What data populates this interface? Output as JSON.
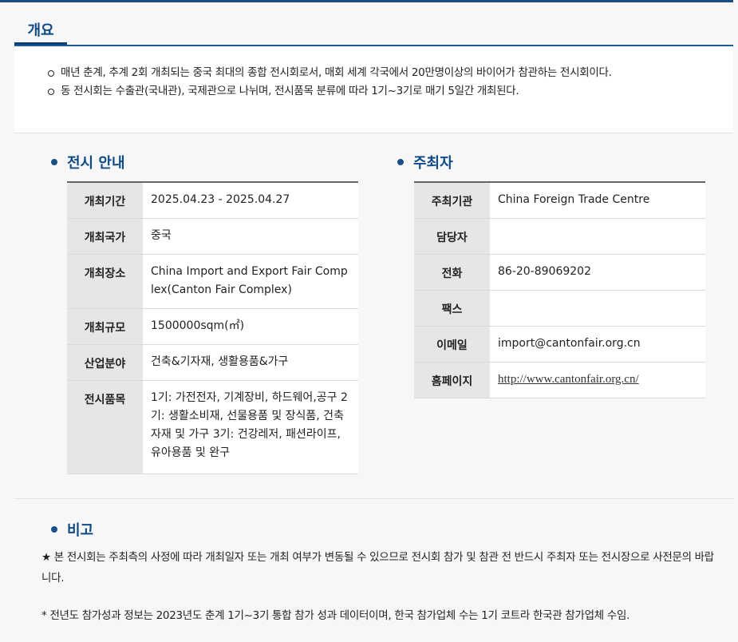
{
  "tab": {
    "label": "개요"
  },
  "overview": {
    "items": [
      "매년 춘계, 추계 2회 개최되는 중국 최대의 종합 전시회로서, 매회 세계 각국에서 20만명이상의 바이어가 참관하는 전시회이다.",
      "동 전시회는 수출관(국내관), 국제관으로 나뉘며, 전시품목 분류에 따라 1기~3기로 매기 5일간 개최된다."
    ]
  },
  "exhibition": {
    "title": "전시 안내",
    "rows": [
      {
        "label": "개최기간",
        "value": "2025.04.23 - 2025.04.27"
      },
      {
        "label": "개최국가",
        "value": "중국"
      },
      {
        "label": "개최장소",
        "value": "China Import and Export Fair Complex(Canton Fair Complex)"
      },
      {
        "label": "개최규모",
        "value": "1500000sqm(㎡)"
      },
      {
        "label": "산업분야",
        "value": "건축&기자재, 생활용품&가구"
      },
      {
        "label": "전시품목",
        "value": "1기: 가전전자, 기계장비, 하드웨어,공구 2기: 생활소비재, 선물용품 및 장식품, 건축자재 및 가구 3기: 건강레저, 패션라이프,유아용품 및 완구"
      }
    ]
  },
  "organizer": {
    "title": "주최자",
    "rows": [
      {
        "label": "주최기관",
        "value": "China Foreign Trade Centre"
      },
      {
        "label": "담당자",
        "value": ""
      },
      {
        "label": "전화",
        "value": "86-20-89069202"
      },
      {
        "label": "팩스",
        "value": ""
      },
      {
        "label": "이메일",
        "value": "import@cantonfair.org.cn"
      },
      {
        "label": "홈페이지",
        "value": "http://www.cantonfair.org.cn/"
      }
    ]
  },
  "remarks": {
    "title": "비고",
    "notice": "★ 본 전시회는 주최측의 사정에 따라 개최일자 또는 개최 여부가 변동될 수 있으므로 전시회 참가 및 참관 전 반드시 주최자 또는 전시장으로 사전문의 바랍니다.",
    "footnote": "* 전년도 참가성과 정보는 2023년도 춘계 1기~3기 통합 참가 성과 데이터이며, 한국 참가업체 수는 1기 코트라 한국관 참가업체 수임."
  }
}
